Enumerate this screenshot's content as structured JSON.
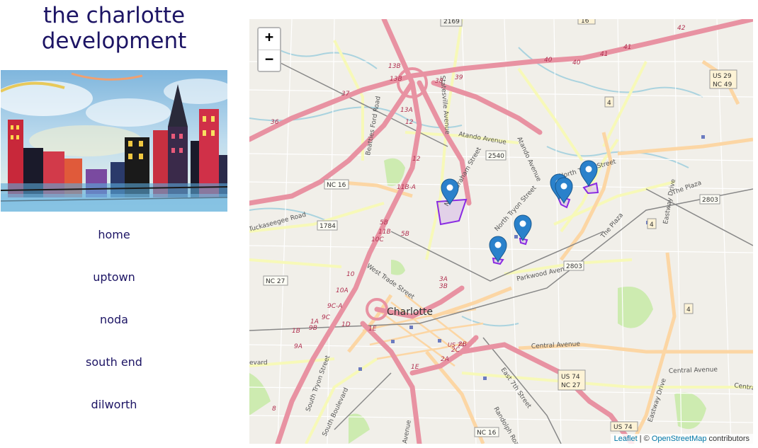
{
  "site": {
    "title_line1": "the charlotte",
    "title_line2": "development"
  },
  "nav": {
    "items": [
      "home",
      "uptown",
      "noda",
      "south end",
      "dilworth"
    ]
  },
  "map": {
    "zoom_in": "+",
    "zoom_out": "−",
    "attribution": {
      "leaflet": "Leaflet",
      "sep": " | © ",
      "osm": "OpenStreetMap",
      "suffix": " contributors"
    },
    "city_label": "Charlotte",
    "roads": {
      "atando": "Atando Avenue",
      "atando2": "Atando Avenue",
      "beatties": "Beatties Ford Road",
      "statesville": "Statesville Avenue",
      "graham": "North Graham Street",
      "tryon": "North Tryon Street",
      "tryon2": "North Tryon Street",
      "parkwood": "Parkwood Avenue",
      "plaza": "The Plaza",
      "plaza2": "The Plaza",
      "eastway": "Eastway Drive",
      "eastway2": "Eastway Drive",
      "central": "Central Avenue",
      "central2": "Central Avenue",
      "central3": "Centra",
      "seventh": "East 7th Street",
      "randolph": "Randolph Road",
      "trade": "West Trade Street",
      "s_tryon": "South Tryon Street",
      "s_blvd": "South Boulevard",
      "tuckaseegee": "Tuckaseegee Road",
      "boulevard": "evard",
      "avenue": "Avenue"
    },
    "shields": {
      "s2169": "2169",
      "nc16": "NC 16",
      "s1784": "1784",
      "nc27": "NC 27",
      "s2540": "2540",
      "s2803a": "2803",
      "s2803b": "2803",
      "us29": "US 29",
      "nc49": "NC 49",
      "s4a": "4",
      "s4b": "4",
      "s4c": "4",
      "us74": "US 74",
      "nc27b": "NC 27",
      "nc16b": "NC 16",
      "us74b": "US 74",
      "s16": "16"
    },
    "exits": [
      "13B",
      "13B",
      "13A",
      "12",
      "11B-A",
      "12",
      "5B",
      "11B",
      "5B",
      "10C",
      "10",
      "10A",
      "9C-A",
      "9C",
      "9B",
      "1A",
      "1B",
      "9A",
      "8",
      "1D",
      "1E",
      "3B",
      "3A",
      "2B",
      "2A",
      "1E",
      "2C",
      "38",
      "39",
      "37",
      "40",
      "40",
      "41",
      "41",
      "42",
      "36",
      "US 74"
    ],
    "markers": 5,
    "colors": {
      "road_major": "#e892a2",
      "road_secondary": "#fcd6a4",
      "road_tertiary": "#f7f9b8",
      "water": "#aad3df",
      "park": "#cdebb0",
      "marker": "#2a81cb",
      "polygon": "#8a2be2"
    }
  }
}
